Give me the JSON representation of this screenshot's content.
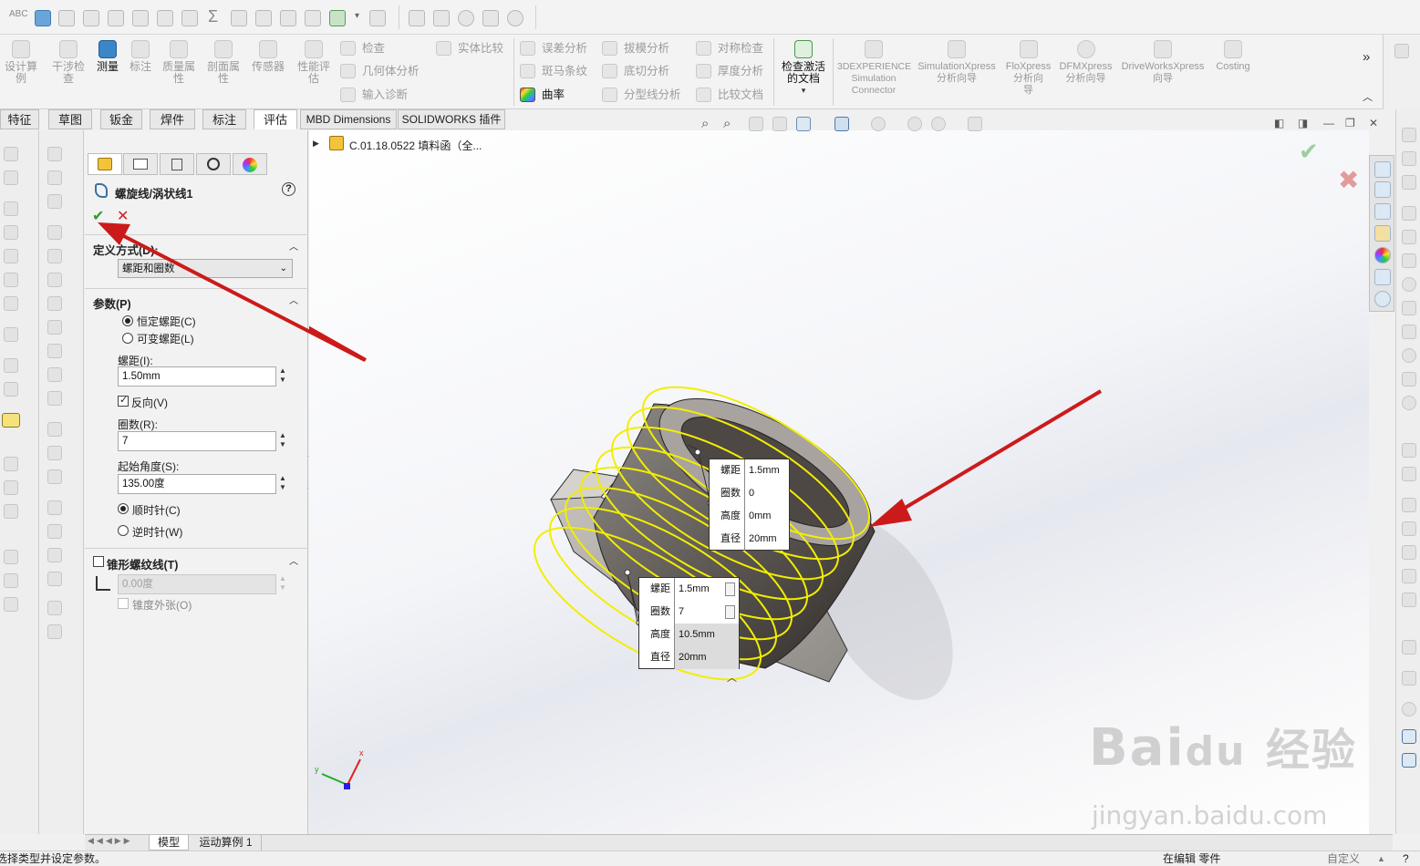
{
  "top_toolbar": {
    "icons": [
      "spelling-icon",
      "measure-icon",
      "mass-icon",
      "section-icon",
      "sensor-icon",
      "check-icon",
      "sum-icon",
      "compare-icon",
      "mirror-icon",
      "star-icon",
      "doc-icon",
      "check-activate-icon",
      "dropdown-icon",
      "close-doc-icon",
      "tool-a-icon",
      "tool-b-icon",
      "ok-circle-icon",
      "stack-icon",
      "globe-icon"
    ]
  },
  "ribbon": {
    "big_buttons": [
      {
        "label": "设计算\n例",
        "active": false
      },
      {
        "label": "干涉检\n查",
        "active": false
      },
      {
        "label": "测量",
        "active": true
      },
      {
        "label": "标注",
        "active": false
      },
      {
        "label": "质量属\n性",
        "active": false
      },
      {
        "label": "剖面属\n性",
        "active": false
      },
      {
        "label": "传感器",
        "active": false
      },
      {
        "label": "性能评\n估",
        "active": false
      }
    ],
    "small_col1": [
      "检查",
      "几何体分析",
      "输入诊断"
    ],
    "small_col2": [
      "实体比较"
    ],
    "small_col3": [
      "误差分析",
      "斑马条纹",
      "曲率"
    ],
    "small_col4": [
      "拔模分析",
      "底切分析",
      "分型线分析"
    ],
    "small_col5": [
      "对称检查",
      "厚度分析",
      "比较文档"
    ],
    "check_activate": "检查激活\n的文档",
    "addins": [
      {
        "label": "3DEXPERIENCE\nSimulation\nConnector"
      },
      {
        "label": "SimulationXpress\n分析向导"
      },
      {
        "label": "FloXpress\n分析向\n导"
      },
      {
        "label": "DFMXpress\n分析向导"
      },
      {
        "label": "DriveWorksXpress\n向导"
      },
      {
        "label": "Costing"
      }
    ],
    "more": "»"
  },
  "tabs": [
    "特征",
    "草图",
    "钣金",
    "焊件",
    "标注",
    "评估",
    "MBD Dimensions",
    "SOLIDWORKS 插件"
  ],
  "active_tab": "评估",
  "property_manager": {
    "title": "螺旋线/涡状线1",
    "help": "?",
    "define_section": "定义方式(D):",
    "define_value": "螺距和圈数",
    "params_section": "参数(P)",
    "radio_constant": "恒定螺距(C)",
    "radio_variable": "可变螺距(L)",
    "pitch_label": "螺距(I):",
    "pitch_value": "1.50mm",
    "reverse_label": "反向(V)",
    "revolutions_label": "圈数(R):",
    "revolutions_value": "7",
    "start_angle_label": "起始角度(S):",
    "start_angle_value": "135.00度",
    "cw_label": "顺时针(C)",
    "ccw_label": "逆时针(W)",
    "taper_section": "锥形螺纹线(T)",
    "taper_value": "0.00度",
    "taper_outward": "锥度外张(O)"
  },
  "tree_item": "C.01.18.0522 填料函（全...",
  "callout_top": {
    "pitch_label": "螺距",
    "pitch": "1.5mm",
    "revs_label": "圈数",
    "revs": "0",
    "height_label": "高度",
    "height": "0mm",
    "dia_label": "直径",
    "dia": "20mm"
  },
  "callout_bottom": {
    "pitch_label": "螺距",
    "pitch": "1.5mm",
    "revs_label": "圈数",
    "revs": "7",
    "height_label": "高度",
    "height": "10.5mm",
    "dia_label": "直径",
    "dia": "20mm"
  },
  "bottom_tabs": [
    "模型",
    "运动算例 1"
  ],
  "status": {
    "left": "选择类型并设定参数。",
    "mid": "在编辑 零件",
    "right": "自定义"
  },
  "watermark": {
    "line1": "Bai",
    "line2": "du",
    "line3": "经验",
    "line4": "jingyan.baidu.com"
  },
  "colors": {
    "helix": "#f2ee00",
    "arrow": "#cc1a1a",
    "ok": "#2f9a2f",
    "cancel": "#d22020",
    "active_tab": "#ffffff"
  }
}
